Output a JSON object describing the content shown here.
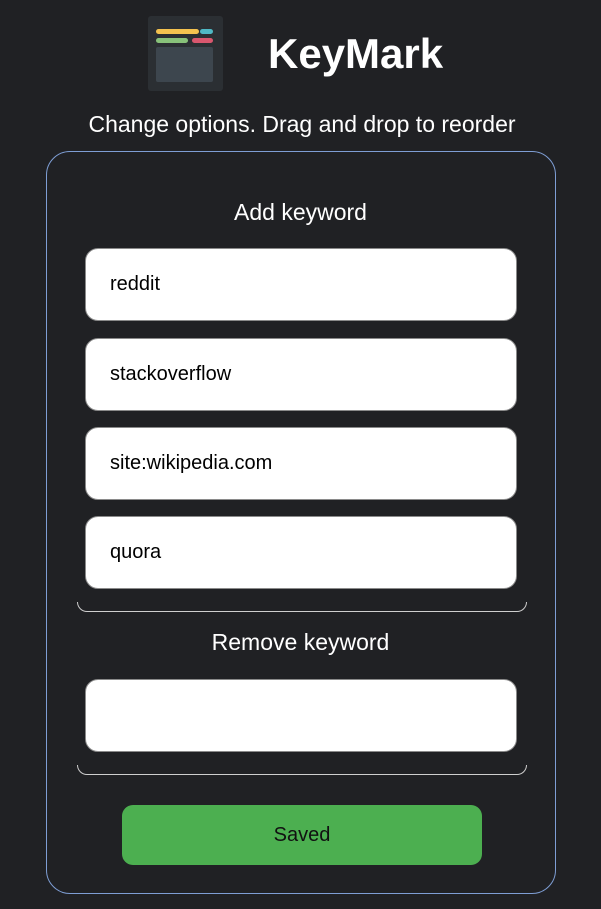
{
  "header": {
    "logo_icon": "keymark-logo-icon",
    "title": "KeyMark"
  },
  "subtitle": "Change options. Drag and drop to reorder",
  "add_section": {
    "heading": "Add keyword",
    "keywords": [
      "reddit",
      "stackoverflow",
      "site:wikipedia.com",
      "quora"
    ]
  },
  "remove_section": {
    "heading": "Remove keyword",
    "value": ""
  },
  "save_button": {
    "label": "Saved",
    "color": "#4caf50"
  },
  "colors": {
    "background": "#202124",
    "card_border": "#7e9ed4"
  }
}
